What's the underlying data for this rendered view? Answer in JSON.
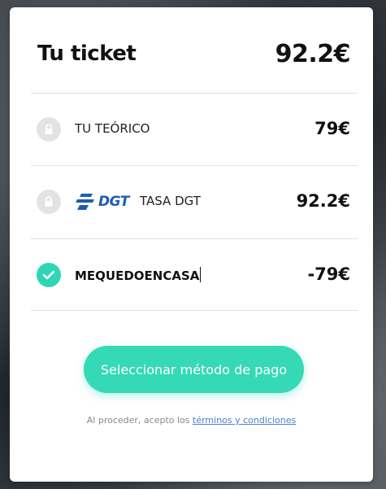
{
  "ticket": {
    "title": "Tu ticket",
    "total": "92.2€"
  },
  "items": [
    {
      "label": "TU TEÓRICO",
      "amount": "79€",
      "icon": "lock-icon"
    },
    {
      "label": "TASA DGT",
      "amount": "92.2€",
      "icon": "lock-icon",
      "logo_text": "DGT"
    },
    {
      "label": "MEQUEDOENCASA",
      "amount": "-79€",
      "icon": "check-icon"
    }
  ],
  "pay_button": {
    "label": "Seleccionar método de pago"
  },
  "terms": {
    "prefix": "Al proceder, acepto los",
    "link_label": "términos y condiciones"
  },
  "colors": {
    "accent": "#35d9b5",
    "check": "#2fd6b3",
    "link": "#4a7fd4",
    "dgt_blue": "#1b5fb0"
  }
}
